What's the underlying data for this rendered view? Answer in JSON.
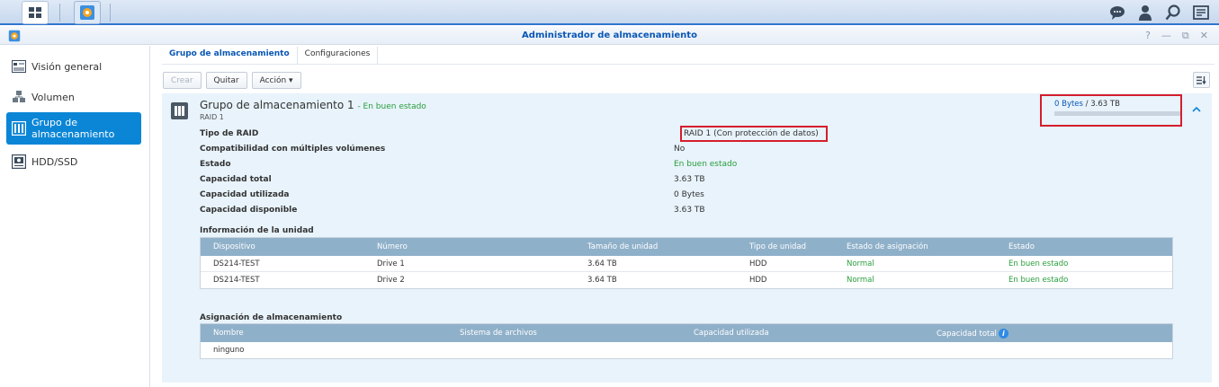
{
  "window": {
    "title": "Administrador de almacenamiento"
  },
  "sidebar": {
    "items": [
      {
        "label": "Visión general",
        "icon": "overview-icon"
      },
      {
        "label": "Volumen",
        "icon": "volume-icon"
      },
      {
        "label": "Grupo de almacenamiento",
        "icon": "storage-pool-icon",
        "active": true
      },
      {
        "label": "HDD/SSD",
        "icon": "disk-icon"
      }
    ]
  },
  "tabs": [
    {
      "label": "Grupo de almacenamiento",
      "active": true
    },
    {
      "label": "Configuraciones"
    }
  ],
  "toolbar": {
    "create": "Crear",
    "remove": "Quitar",
    "action": "Acción ▾"
  },
  "pool": {
    "title": "Grupo de almacenamiento 1",
    "status_inline": "- En buen estado",
    "subtitle": "RAID 1",
    "usage_used": "0 Bytes",
    "usage_sep": " / ",
    "usage_total": "3.63 TB",
    "usage_fraction": 0.0,
    "properties": [
      {
        "label": "Tipo de RAID",
        "value": "RAID 1 (Con protección de datos)",
        "color": "#333333"
      },
      {
        "label": "Compatibilidad con múltiples volúmenes",
        "value": "No",
        "color": "#333333"
      },
      {
        "label": "Estado",
        "value": "En buen estado",
        "color": "#2a9e3d"
      },
      {
        "label": "Capacidad total",
        "value": "3.63 TB",
        "color": "#333333"
      },
      {
        "label": "Capacidad utilizada",
        "value": "0 Bytes",
        "color": "#333333"
      },
      {
        "label": "Capacidad disponible",
        "value": "3.63 TB",
        "color": "#333333"
      }
    ]
  },
  "drives": {
    "section_title": "Información de la unidad",
    "columns": [
      "Dispositivo",
      "Número",
      "Tamaño de unidad",
      "Tipo de unidad",
      "Estado de asignación",
      "Estado"
    ],
    "rows": [
      [
        "DS214-TEST",
        "Drive 1",
        "3.64 TB",
        "HDD",
        "Normal",
        "En buen estado"
      ],
      [
        "DS214-TEST",
        "Drive 2",
        "3.64 TB",
        "HDD",
        "Normal",
        "En buen estado"
      ]
    ]
  },
  "allocation": {
    "section_title": "Asignación de almacenamiento",
    "columns": [
      "Nombre",
      "Sistema de archivos",
      "Capacidad utilizada",
      "Capacidad total"
    ],
    "rows": [
      [
        "ninguno",
        "",
        "",
        ""
      ]
    ]
  },
  "colors": {
    "accent": "#0b86d6",
    "good": "#2a9e3d",
    "highlight": "#d51d2c",
    "header": "#8fb0c9"
  }
}
